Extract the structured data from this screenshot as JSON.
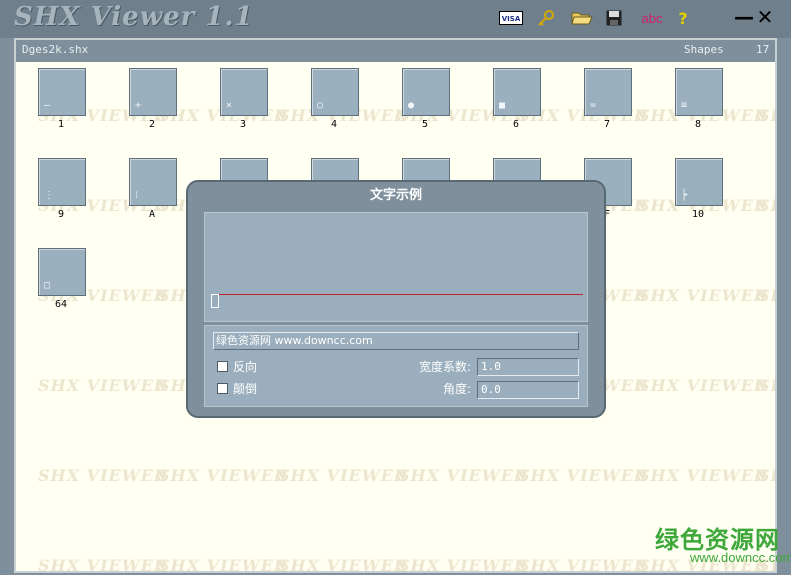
{
  "app": {
    "title": "SHX Viewer 1.1"
  },
  "toolbar": {
    "visa_label": "VISA",
    "abc_label": "abc",
    "help_label": "?",
    "minimize_label": "—",
    "close_label": "✕"
  },
  "header": {
    "file_name": "Dges2k.shx",
    "shapes_label": "Shapes",
    "shapes_count": "17"
  },
  "watermark_text": "SHX VIEWER",
  "tiles": [
    {
      "label": "1",
      "glyph": "—"
    },
    {
      "label": "2",
      "glyph": "+"
    },
    {
      "label": "3",
      "glyph": "×"
    },
    {
      "label": "4",
      "glyph": "○"
    },
    {
      "label": "5",
      "glyph": "●"
    },
    {
      "label": "6",
      "glyph": "■"
    },
    {
      "label": "7",
      "glyph": "="
    },
    {
      "label": "8",
      "glyph": "≡"
    },
    {
      "label": "9",
      "glyph": "⋮"
    },
    {
      "label": "A",
      "glyph": "⁝"
    },
    {
      "label": "",
      "glyph": ""
    },
    {
      "label": "",
      "glyph": ""
    },
    {
      "label": "",
      "glyph": ""
    },
    {
      "label": "",
      "glyph": ""
    },
    {
      "label": "F",
      "glyph": "├"
    },
    {
      "label": "10",
      "glyph": "┝"
    },
    {
      "label": "64",
      "glyph": "□"
    }
  ],
  "dialog": {
    "title": "文字示例",
    "sample_text": "绿色资源网 www.downcc.com",
    "reverse_label": "反向",
    "upside_down_label": "颠倒",
    "width_factor_label": "宽度系数:",
    "width_factor_value": "1.0",
    "angle_label": "角度:",
    "angle_value": "0.0"
  },
  "brand": {
    "name": "绿色资源网",
    "url": "www.downcc.com"
  },
  "colors": {
    "panel_bg": "#fffff2",
    "tile_bg": "#9ab0bf",
    "frame": "#7f909c",
    "baseline": "#c0202c",
    "brand": "#3ea83a"
  }
}
